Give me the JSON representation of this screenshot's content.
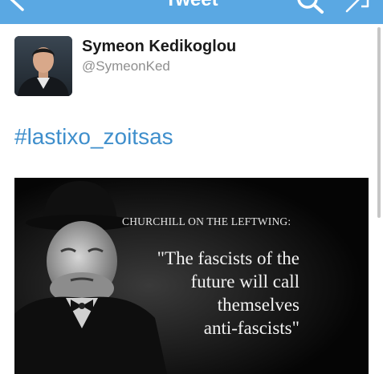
{
  "navbar": {
    "title": "Tweet",
    "back_icon": "chevron-left-icon",
    "search_icon": "search-icon",
    "compose_icon": "compose-icon",
    "background_color": "#5aa8e3"
  },
  "tweet": {
    "author_name": "Symeon Kedikoglou",
    "author_handle": "@SymeonKed",
    "text": "#lastixo_zoitsas",
    "link_color": "#3f8fcc",
    "media": {
      "heading": "CHURCHILL ON THE LEFTWING:",
      "quote_lines": [
        "\"The fascists of the",
        "future will call",
        "themselves",
        "anti-fascists\""
      ]
    }
  }
}
